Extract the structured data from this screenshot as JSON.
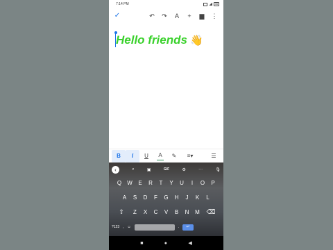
{
  "status_bar": {
    "time": "7:14 PM",
    "battery": "35"
  },
  "toolbar": {
    "check_icon": "check-icon",
    "undo_icon": "undo-icon",
    "redo_icon": "redo-icon",
    "text_format_label": "A",
    "add_label": "+",
    "comment_icon": "comment-icon",
    "more_label": "⋮"
  },
  "document": {
    "text": "Hello friends",
    "emoji": "👋",
    "text_color": "#3ad12c"
  },
  "format_bar": {
    "bold": "B",
    "italic": "I",
    "underline": "U",
    "text_color": "A",
    "highlight_icon": "pen-icon",
    "align_icon": "align-icon",
    "list_icon": "list-icon"
  },
  "keyboard": {
    "top": {
      "gif": "GIF"
    },
    "row1": [
      "Q",
      "W",
      "E",
      "R",
      "T",
      "Y",
      "U",
      "I",
      "O",
      "P"
    ],
    "row2": [
      "A",
      "S",
      "D",
      "F",
      "G",
      "H",
      "J",
      "K",
      "L"
    ],
    "row3": [
      "Z",
      "X",
      "C",
      "V",
      "B",
      "N",
      "M"
    ],
    "symbols": "?123",
    "comma": ",",
    "period": "."
  },
  "nav": {
    "home": "●",
    "back": "◀",
    "recents": "■"
  }
}
